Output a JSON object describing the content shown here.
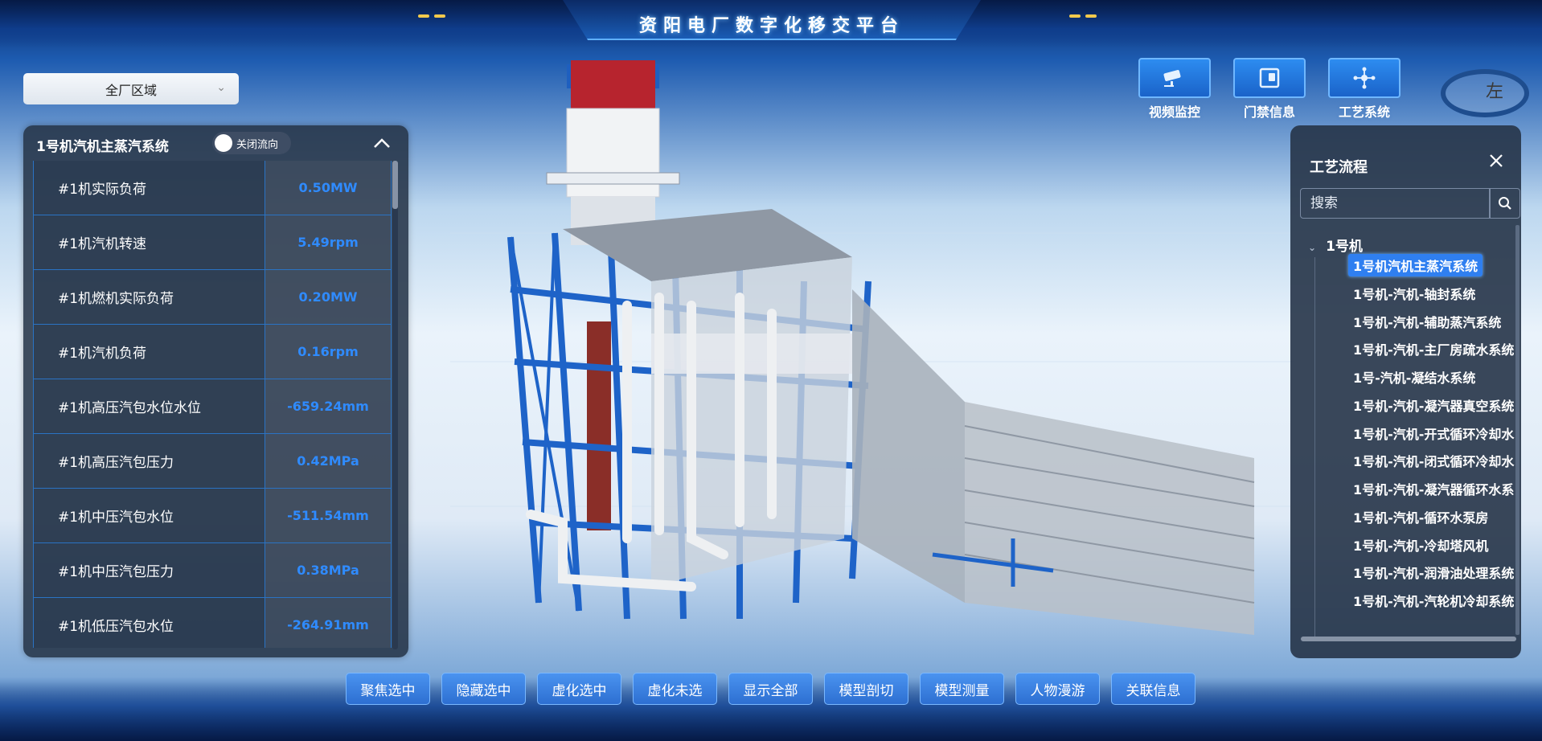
{
  "app": {
    "title": "资阳电厂数字化移交平台"
  },
  "area_select": {
    "value": "全厂区域"
  },
  "left_panel": {
    "title": "1号机汽机主蒸汽系统",
    "toggle_label": "关闭流向",
    "rows": [
      {
        "name": "#1机实际负荷",
        "value": "0.50MW"
      },
      {
        "name": "#1机汽机转速",
        "value": "5.49rpm"
      },
      {
        "name": "#1机燃机实际负荷",
        "value": "0.20MW"
      },
      {
        "name": "#1机汽机负荷",
        "value": "0.16rpm"
      },
      {
        "name": "#1机高压汽包水位水位",
        "value": "-659.24mm"
      },
      {
        "name": "#1机高压汽包压力",
        "value": "0.42MPa"
      },
      {
        "name": "#1机中压汽包水位",
        "value": "-511.54mm"
      },
      {
        "name": "#1机中压汽包压力",
        "value": "0.38MPa"
      },
      {
        "name": "#1机低压汽包水位",
        "value": "-264.91mm"
      }
    ]
  },
  "top_tools": [
    {
      "label": "视频监控",
      "icon": "camera-icon"
    },
    {
      "label": "门禁信息",
      "icon": "door-icon"
    },
    {
      "label": "工艺系统",
      "icon": "network-icon"
    }
  ],
  "corner_gauge": {
    "label": "左"
  },
  "right_panel": {
    "title": "工艺流程",
    "search_placeholder": "搜索",
    "tree_root": "1号机",
    "items": [
      "1号机汽机主蒸汽系统",
      "1号机-汽机-轴封系统",
      "1号机-汽机-辅助蒸汽系统",
      "1号机-汽机-主厂房疏水系统",
      "1号-汽机-凝结水系统",
      "1号机-汽机-凝汽器真空系统",
      "1号机-汽机-开式循环冷却水",
      "1号机-汽机-闭式循环冷却水",
      "1号机-汽机-凝汽器循环水系",
      "1号机-汽机-循环水泵房",
      "1号机-汽机-冷却塔风机",
      "1号机-汽机-润滑油处理系统",
      "1号机-汽机-汽轮机冷却系统"
    ]
  },
  "toolbar": [
    "聚焦选中",
    "隐藏选中",
    "虚化选中",
    "虚化未选",
    "显示全部",
    "模型剖切",
    "模型测量",
    "人物漫游",
    "关联信息"
  ],
  "colors": {
    "accent": "#2f7ff0",
    "value": "#2f8bff",
    "panel": "#263448"
  }
}
